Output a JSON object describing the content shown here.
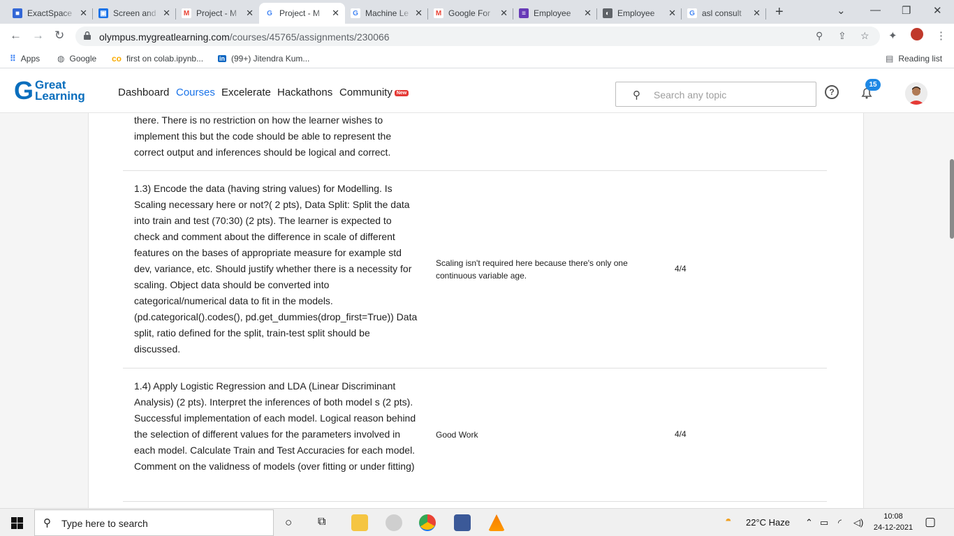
{
  "browser": {
    "tabs": [
      {
        "title": "ExactSpace",
        "favicon_color": "#3367d6",
        "favicon": "■"
      },
      {
        "title": "Screen and",
        "favicon_color": "#1a73e8",
        "favicon": "▣"
      },
      {
        "title": "Project - M",
        "favicon_color": "#ea4335",
        "favicon": "M"
      },
      {
        "title": "Project - M",
        "favicon_color": "#4285f4",
        "favicon": "G",
        "active": true
      },
      {
        "title": "Machine Le",
        "favicon_color": "#4285f4",
        "favicon": "G"
      },
      {
        "title": "Google For",
        "favicon_color": "#ea4335",
        "favicon": "M"
      },
      {
        "title": "Employee",
        "favicon_color": "#673ab7",
        "favicon": "≡"
      },
      {
        "title": "Employee",
        "favicon_color": "#5f6368",
        "favicon": "◐"
      },
      {
        "title": "asl consult",
        "favicon_color": "#4285f4",
        "favicon": "G"
      }
    ],
    "url_host": "olympus.mygreatlearning.com",
    "url_path": "/courses/45765/assignments/230066",
    "bookmarks": [
      {
        "label": "Apps",
        "icon": "apps-grid-icon"
      },
      {
        "label": "Google",
        "icon": "globe-icon"
      },
      {
        "label": "first on colab.ipynb...",
        "icon": "colab-icon"
      },
      {
        "label": "(99+) Jitendra Kum...",
        "icon": "linkedin-icon"
      }
    ],
    "reading_list": "Reading list"
  },
  "site": {
    "logo_top": "Great",
    "logo_bottom": "Learning",
    "nav": [
      "Dashboard",
      "Courses",
      "Excelerate",
      "Hackathons",
      "Community"
    ],
    "active_nav": "Courses",
    "new_badge": "New",
    "search_placeholder": "Search any topic",
    "notification_count": "15"
  },
  "rubric": {
    "row0_text": "there. There is no restriction on how the learner wishes to implement this but the code should be able to represent the correct output and inferences should be logical and correct.",
    "rows": [
      {
        "criterion": "1.3) Encode the data (having string values) for Modelling. Is Scaling necessary here or not?( 2 pts), Data Split: Split the data into train and test (70:30) (2 pts). The learner is expected to check and comment about the difference in scale of different features on the bases of appropriate measure for example std dev, variance, etc. Should justify whether there is a necessity for scaling. Object data should be converted into categorical/numerical data to fit in the models. (pd.categorical().codes(), pd.get_dummies(drop_first=True)) Data split, ratio defined for the split, train-test split should be discussed.",
        "comment": "Scaling isn't required here because there's only one continuous variable age.",
        "score": "4/4"
      },
      {
        "criterion": "1.4) Apply Logistic Regression and LDA (Linear Discriminant Analysis) (2 pts). Interpret the inferences of both model s (2 pts). Successful implementation of each model. Logical reason behind the selection of different values for the parameters involved in each model. Calculate Train and Test Accuracies for each model. Comment on the validness of models (over fitting or under fitting)",
        "comment": "Good Work",
        "score": "4/4"
      }
    ]
  },
  "taskbar": {
    "search_placeholder": "Type here to search",
    "weather": "22°C  Haze",
    "time": "10:08",
    "date": "24-12-2021"
  }
}
